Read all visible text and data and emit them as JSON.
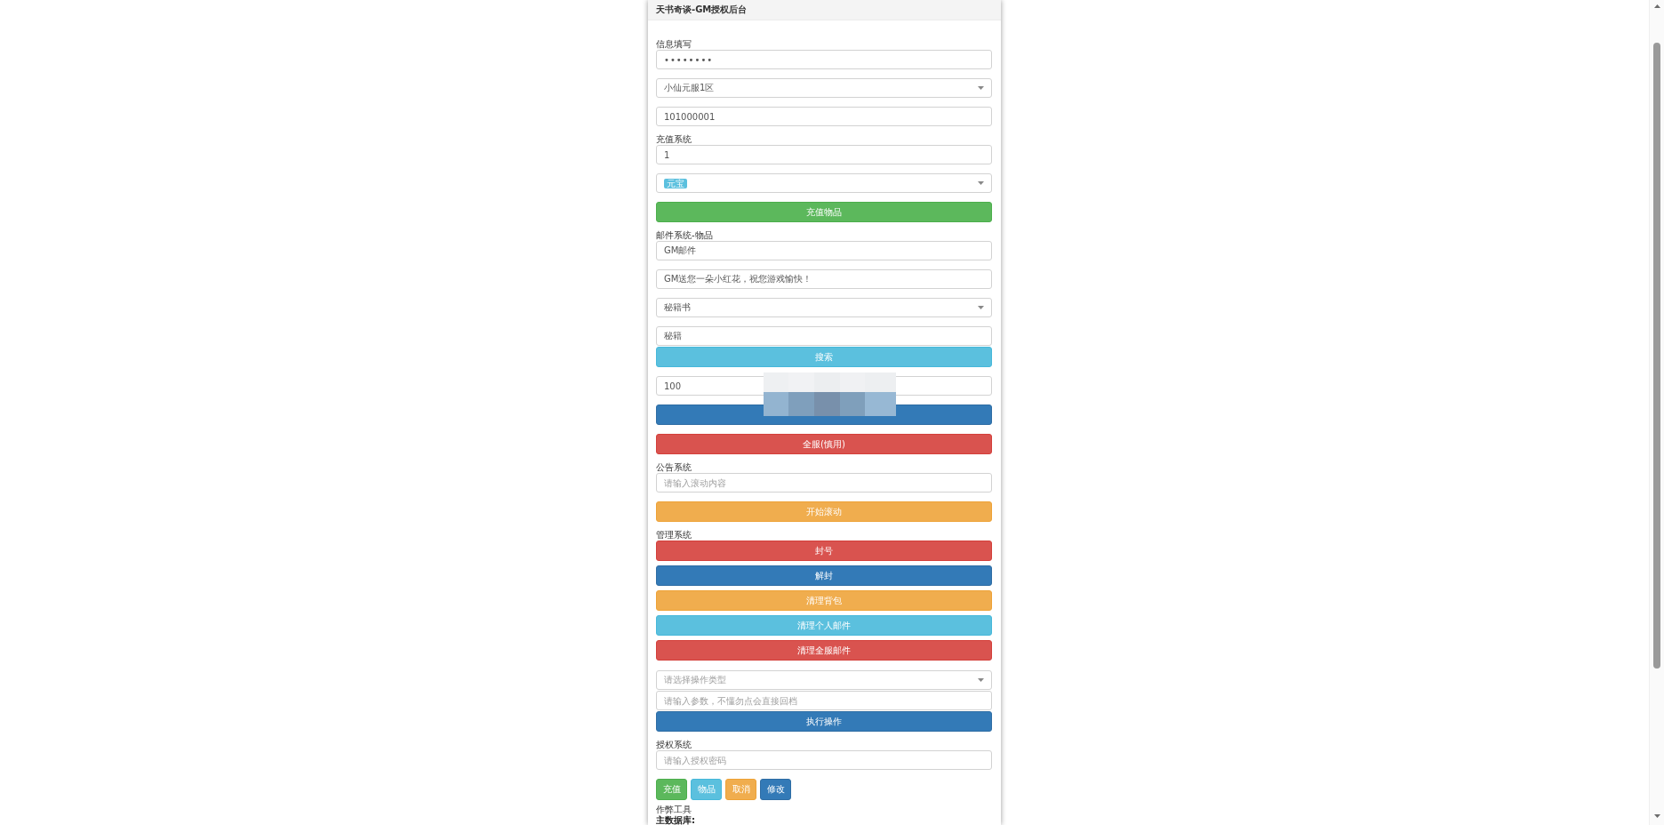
{
  "panel": {
    "title": "天书奇谈-GM授权后台",
    "sections": [
      {
        "heading": "信息填写",
        "kind": "form",
        "controls": [
          {
            "kind": "password",
            "value": "••••••••"
          },
          {
            "kind": "select",
            "value": "小仙元服1区"
          },
          {
            "kind": "input",
            "value": "101000001"
          }
        ]
      },
      {
        "heading": "充值系统",
        "kind": "form",
        "controls": [
          {
            "kind": "input",
            "value": "1"
          },
          {
            "kind": "select",
            "tags": [
              "元宝"
            ]
          },
          {
            "kind": "button",
            "label": "充值物品"
          }
        ]
      },
      {
        "heading": "邮件系统-物品",
        "kind": "form",
        "controls": [
          {
            "kind": "input",
            "value": "GM邮件"
          },
          {
            "kind": "input",
            "value": "GM送您一朵小红花，祝您游戏愉快！"
          },
          {
            "kind": "select",
            "value": "秘籍书"
          },
          {
            "kind": "group",
            "controls": [
              {
                "kind": "input",
                "value": "秘籍"
              },
              {
                "kind": "button",
                "label": "搜索"
              }
            ]
          },
          {
            "kind": "input",
            "value": "100"
          },
          {
            "kind": "button",
            "redacted": true
          },
          {
            "kind": "button",
            "label": "全服(慎用)"
          }
        ]
      },
      {
        "heading": "公告系统",
        "kind": "form",
        "controls": [
          {
            "kind": "input",
            "placeholder": "请输入滚动内容"
          },
          {
            "kind": "button",
            "label": "开始滚动"
          }
        ]
      },
      {
        "heading": "管理系统",
        "kind": "actions",
        "controls": [
          {
            "kind": "button",
            "label": "封号"
          },
          {
            "kind": "button",
            "label": "解封"
          },
          {
            "kind": "button",
            "label": "清理背包"
          },
          {
            "kind": "button",
            "label": "清理个人邮件"
          },
          {
            "kind": "button",
            "label": "清理全服邮件"
          }
        ]
      },
      {
        "kind": "form",
        "controls": [
          {
            "kind": "group",
            "controls": [
              {
                "kind": "select",
                "placeholder": "请选择操作类型"
              },
              {
                "kind": "input",
                "placeholder": "请输入参数，不懂勿点会直接回档"
              },
              {
                "kind": "button",
                "label": "执行操作"
              }
            ]
          }
        ]
      },
      {
        "heading": "授权系统",
        "kind": "form",
        "controls": [
          {
            "kind": "input",
            "placeholder": "请输入授权密码"
          },
          {
            "kind": "button-row",
            "buttons": [
              {
                "label": "充值"
              },
              {
                "label": "物品"
              },
              {
                "label": "取消"
              },
              {
                "label": "修改"
              }
            ]
          }
        ]
      }
    ],
    "footer": {
      "label": "作弊工具",
      "heading": "主数据库:"
    }
  }
}
